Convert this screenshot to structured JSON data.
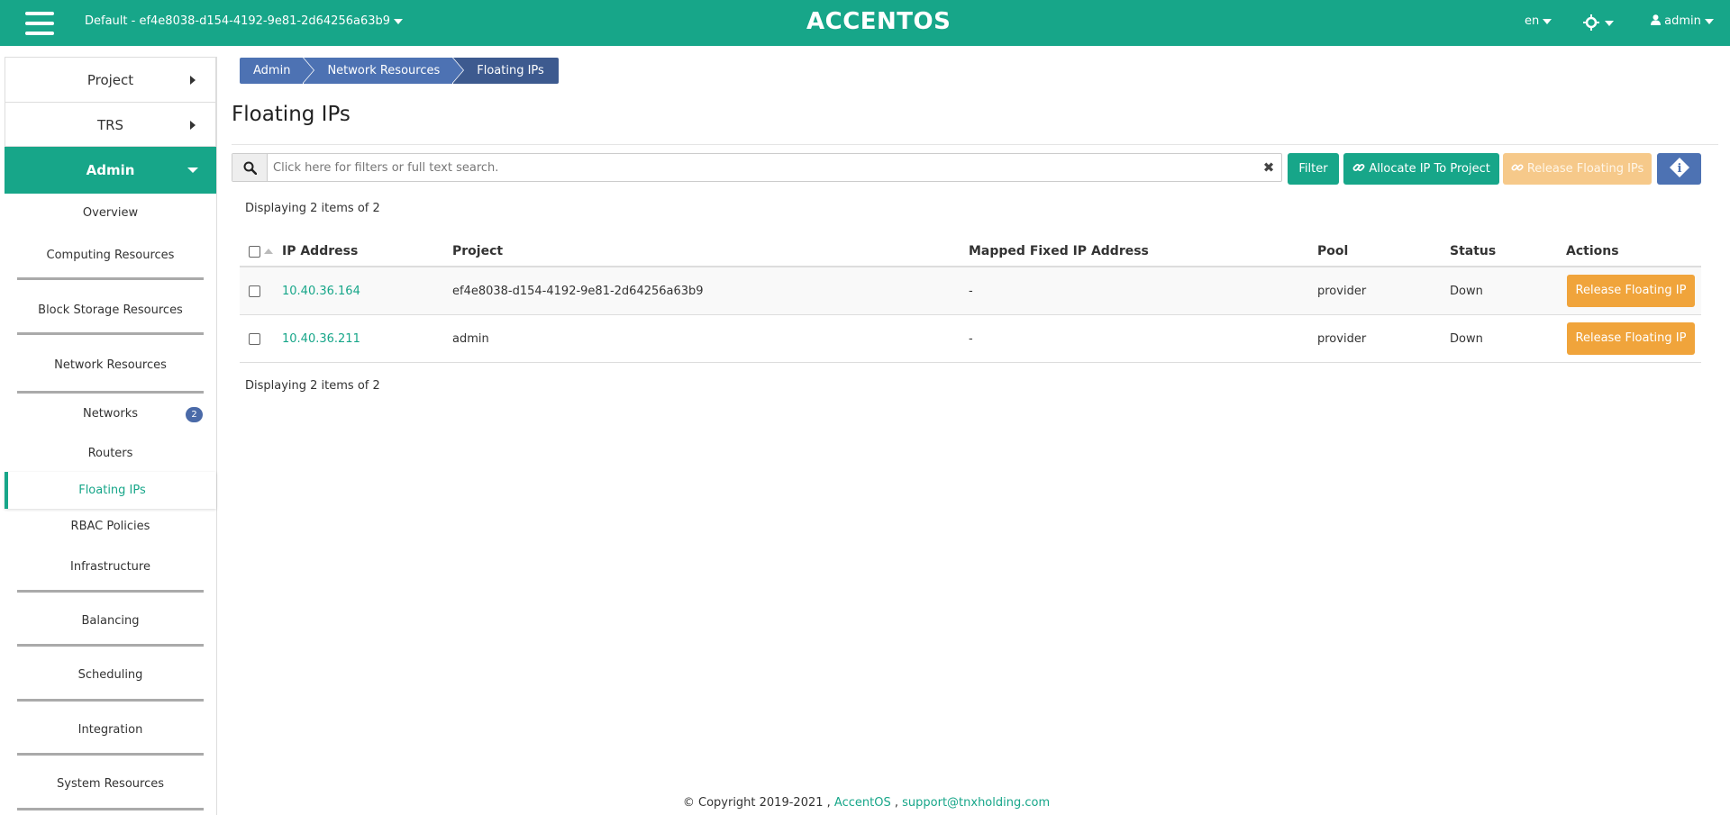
{
  "topbar": {
    "project": "Default - ef4e8038-d154-4192-9e81-2d64256a63b9",
    "logo": "ACCENTOS",
    "lang": "en",
    "user": "admin",
    "colors": {
      "primary": "#17a689",
      "secondary": "#4d72b3",
      "warning": "#f0a43b"
    }
  },
  "sidebar": {
    "project": "Project",
    "trs": "TRS",
    "admin": "Admin",
    "items": {
      "overview": "Overview",
      "computing": "Computing Resources",
      "block_storage": "Block Storage Resources",
      "network": "Network Resources",
      "networks": "Networks",
      "networks_badge": "2",
      "routers": "Routers",
      "floating_ips": "Floating IPs",
      "rbac": "RBAC Policies",
      "infrastructure": "Infrastructure",
      "balancing": "Balancing",
      "scheduling": "Scheduling",
      "integration": "Integration",
      "system": "System Resources"
    }
  },
  "breadcrumb": [
    "Admin",
    "Network Resources",
    "Floating IPs"
  ],
  "page_title": "Floating IPs",
  "search": {
    "placeholder": "Click here for filters or full text search.",
    "clear": "✖"
  },
  "buttons": {
    "filter": "Filter",
    "allocate": "Allocate IP To Project",
    "release_all": "Release Floating IPs",
    "info": "i"
  },
  "display_count": "Displaying 2 items of 2",
  "table": {
    "headers": {
      "ip": "IP Address",
      "project": "Project",
      "mapped": "Mapped Fixed IP Address",
      "pool": "Pool",
      "status": "Status",
      "actions": "Actions"
    },
    "rows": [
      {
        "ip": "10.40.36.164",
        "project": "ef4e8038-d154-4192-9e81-2d64256a63b9",
        "mapped": "-",
        "pool": "provider",
        "status": "Down",
        "action": "Release Floating IP"
      },
      {
        "ip": "10.40.36.211",
        "project": "admin",
        "mapped": "-",
        "pool": "provider",
        "status": "Down",
        "action": "Release Floating IP"
      }
    ]
  },
  "footer": {
    "copyright": "© Copyright 2019-2021 ,",
    "brand": "AccentOS",
    "sep": ",",
    "email": "support@tnxholding.com"
  }
}
